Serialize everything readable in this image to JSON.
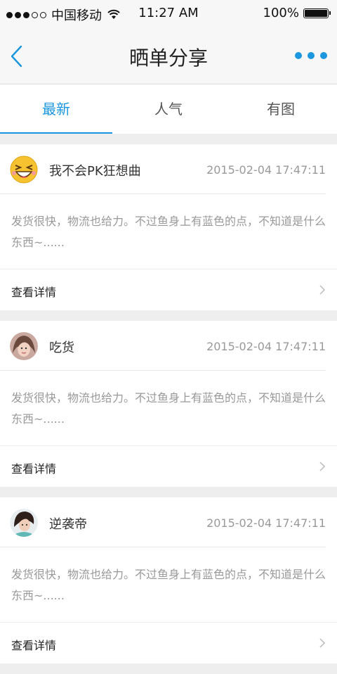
{
  "status_bar": {
    "carrier": "中国移动",
    "time": "11:27 AM",
    "battery": "100%"
  },
  "nav": {
    "title": "晒单分享",
    "back_icon": "chevron-left-icon",
    "more_icon": "more-dots-icon",
    "accent": "#1a97df"
  },
  "tabs": [
    {
      "label": "最新",
      "active": true
    },
    {
      "label": "人气",
      "active": false
    },
    {
      "label": "有图",
      "active": false
    }
  ],
  "posts": [
    {
      "username": "我不会PK狂想曲",
      "time": "2015-02-04 17:47:11",
      "content": "发货很快，物流也给力。不过鱼身上有蓝色的点，不知道是什么东西~......",
      "detail_label": "查看详情",
      "avatar": "laughing-emoji-avatar"
    },
    {
      "username": "吃货",
      "time": "2015-02-04 17:47:11",
      "content": "发货很快，物流也给力。不过鱼身上有蓝色的点，不知道是什么东西~......",
      "detail_label": "查看详情",
      "avatar": "girl-photo-avatar"
    },
    {
      "username": "逆袭帝",
      "time": "2015-02-04 17:47:11",
      "content": "发货很快，物流也给力。不过鱼身上有蓝色的点，不知道是什么东西~......",
      "detail_label": "查看详情",
      "avatar": "girl-photo-avatar"
    }
  ]
}
